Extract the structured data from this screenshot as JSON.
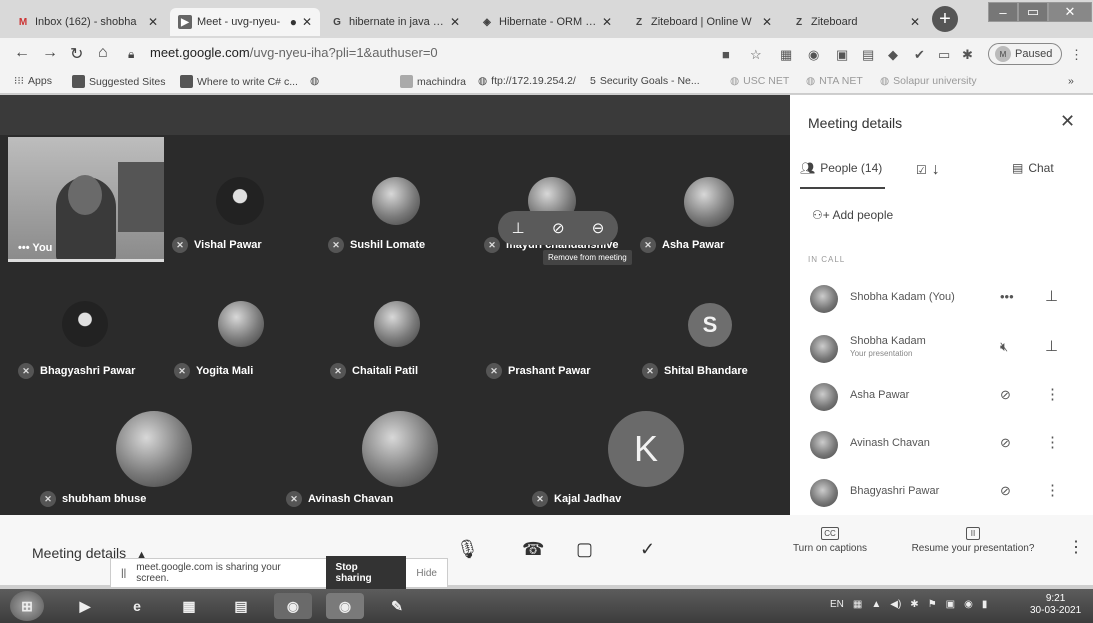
{
  "browser": {
    "tabs": [
      {
        "title": "Inbox (162) - shobha",
        "icon": "gmail-icon",
        "icon_glyph": "M"
      },
      {
        "title": "Meet - uvg-nyeu-",
        "icon": "meet-icon",
        "icon_glyph": "▶",
        "active": true
      },
      {
        "title": "hibernate in java - Go",
        "icon": "google-icon",
        "icon_glyph": "G"
      },
      {
        "title": "Hibernate - ORM Ove",
        "icon": "hibernate-icon",
        "icon_glyph": "◈"
      },
      {
        "title": "Ziteboard | Online W",
        "icon": "ziteboard-icon",
        "icon_glyph": "Z"
      },
      {
        "title": "Ziteboard",
        "icon": "ziteboard-icon",
        "icon_glyph": "Z"
      }
    ],
    "new_tab": "+",
    "url_host": "meet.google.com",
    "url_path": "/uvg-nyeu-iha?pli=1&authuser=0",
    "profile_status": "Paused",
    "bookmarks": [
      {
        "label": "Apps"
      },
      {
        "label": "Suggested Sites"
      },
      {
        "label": "Where to write C# c..."
      },
      {
        "label": ""
      },
      {
        "label": "machindra"
      },
      {
        "label": "ftp://172.19.254.2/"
      },
      {
        "label": "Security Goals - Ne..."
      },
      {
        "label": "USC NET"
      },
      {
        "label": "NTA NET"
      },
      {
        "label": "Solapur university"
      }
    ]
  },
  "meet": {
    "you_label": "You",
    "tiles": [
      {
        "name": "Vishal Pawar"
      },
      {
        "name": "Sushil Lomate"
      },
      {
        "name": "mayuri chandanshive"
      },
      {
        "name": "Asha Pawar"
      },
      {
        "name": "Bhagyashri Pawar"
      },
      {
        "name": "Yogita Mali"
      },
      {
        "name": "Chaitali Patil"
      },
      {
        "name": "Prashant Pawar"
      },
      {
        "name": "Shital Bhandare",
        "letter": "S"
      },
      {
        "name": "shubham bhuse"
      },
      {
        "name": "Avinash Chavan"
      },
      {
        "name": "Kajal Jadhav",
        "letter": "K"
      }
    ],
    "tooltip": "Remove from meeting"
  },
  "panel": {
    "title": "Meeting details",
    "tab_people": "People (14)",
    "tab_chat": "Chat",
    "add_people": "Add people",
    "in_call": "IN CALL",
    "participants": [
      {
        "name": "Shobha Kadam (You)",
        "sub": ""
      },
      {
        "name": "Shobha Kadam",
        "sub": "Your presentation"
      },
      {
        "name": "Asha Pawar",
        "sub": ""
      },
      {
        "name": "Avinash Chavan",
        "sub": ""
      },
      {
        "name": "Bhagyashri Pawar",
        "sub": ""
      }
    ]
  },
  "bottom": {
    "meeting_details": "Meeting details",
    "captions_label": "Turn on captions",
    "captions_icon": "CC",
    "resume_label": "Resume your presentation?",
    "share_notice": "meet.google.com is sharing your screen.",
    "stop_sharing": "Stop sharing",
    "hide": "Hide"
  },
  "taskbar": {
    "lang": "EN",
    "time": "9:21",
    "date": "30-03-2021"
  }
}
